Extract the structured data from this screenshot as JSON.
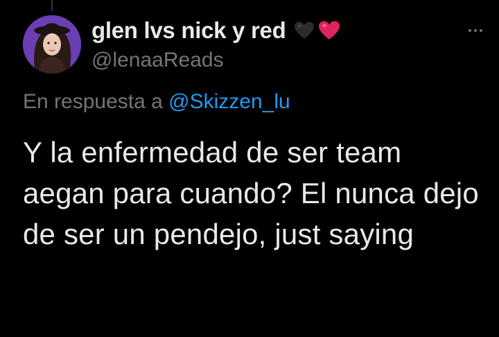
{
  "tweet": {
    "display_name": "glen lvs nick y red",
    "handle": "@lenaaReads",
    "reply_prefix": "En respuesta a",
    "reply_mention": "@Skizzen_lu",
    "body": "Y la enfermedad de ser team aegan para cuando? El nunca dejo de ser un pendejo, just saying",
    "name_emojis": [
      "black-heart-icon",
      "red-heart-icon"
    ]
  },
  "colors": {
    "background": "#000000",
    "text_primary": "#e7e9ea",
    "text_secondary": "#71767b",
    "link": "#1d9bf0",
    "avatar_bg": "#6a3fb5",
    "heart_red": "#e0245e",
    "heart_black": "#2b2b2b"
  },
  "icons": {
    "more": "more-options-icon",
    "avatar": "profile-avatar"
  }
}
